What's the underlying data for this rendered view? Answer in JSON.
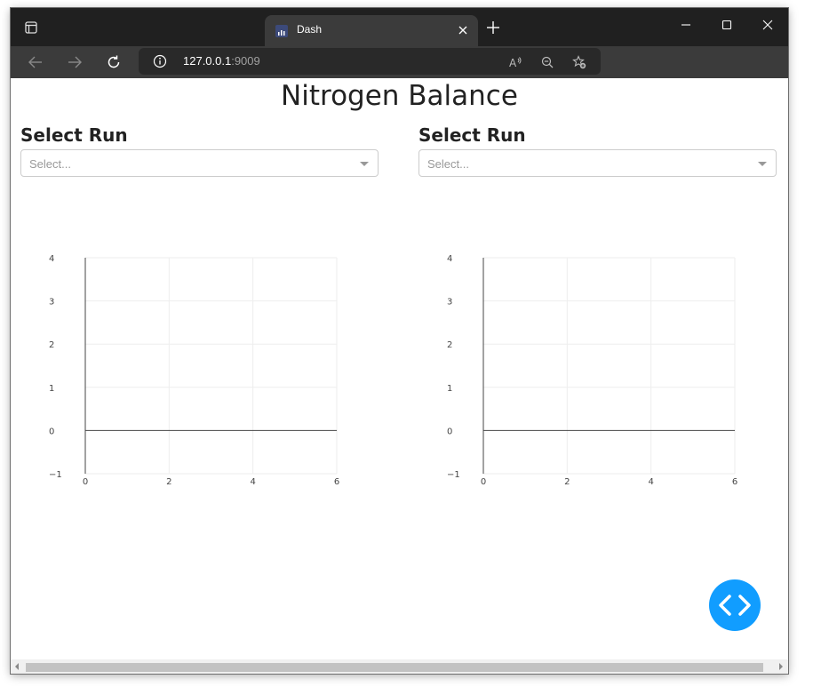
{
  "browser": {
    "tab_title": "Dash",
    "url_host": "127.0.0.1",
    "url_port": ":9009"
  },
  "page": {
    "title": "Nitrogen Balance",
    "selectors": [
      {
        "label": "Select Run",
        "placeholder": "Select..."
      },
      {
        "label": "Select Run",
        "placeholder": "Select..."
      }
    ]
  },
  "chart_data": [
    {
      "type": "scatter",
      "x": [],
      "y": [],
      "xlim": [
        -0.0,
        6
      ],
      "ylim": [
        -1,
        4
      ],
      "x_ticks": [
        "0",
        "2",
        "4",
        "6"
      ],
      "y_ticks": [
        "−1",
        "0",
        "1",
        "2",
        "3",
        "4"
      ],
      "grid": true
    },
    {
      "type": "scatter",
      "x": [],
      "y": [],
      "xlim": [
        -0.0,
        6
      ],
      "ylim": [
        -1,
        4
      ],
      "x_ticks": [
        "0",
        "2",
        "4",
        "6"
      ],
      "y_ticks": [
        "−1",
        "0",
        "1",
        "2",
        "3",
        "4"
      ],
      "grid": true
    }
  ],
  "colors": {
    "fab": "#119dff",
    "titlebar": "#202020",
    "toolbar": "#3b3b3b"
  },
  "icons": {
    "fab": "code-brackets-icon"
  }
}
